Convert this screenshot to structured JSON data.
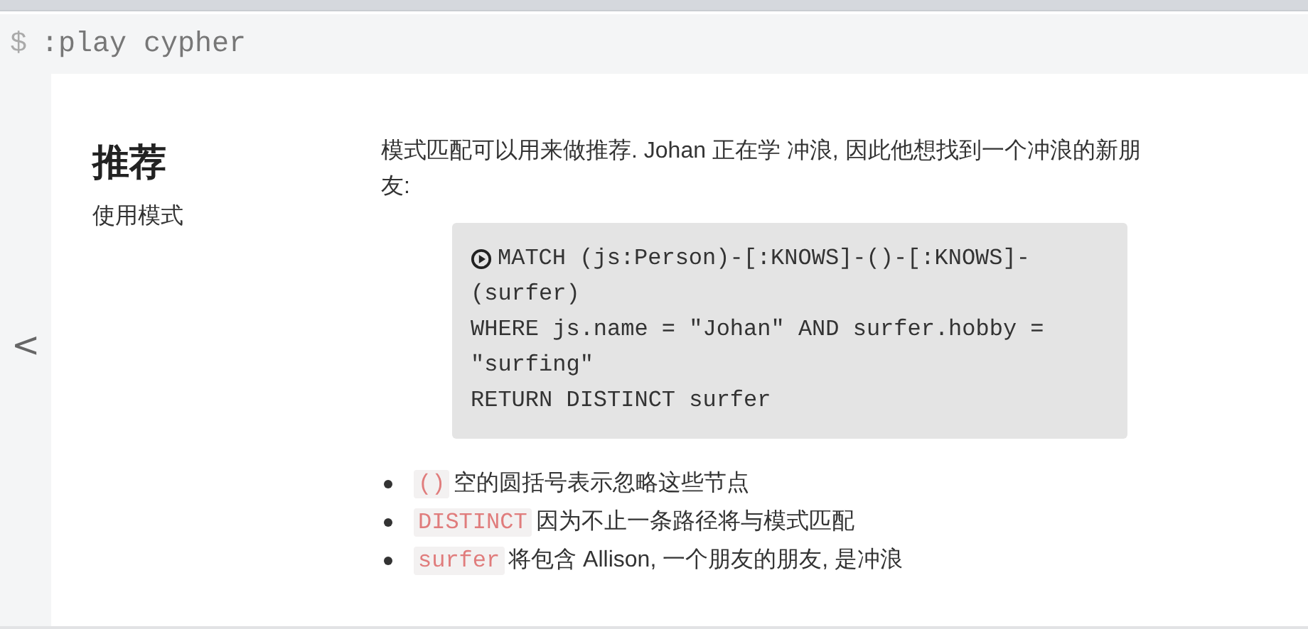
{
  "command_bar": {
    "prompt": "$",
    "command": ":play cypher"
  },
  "slide": {
    "title": "推荐",
    "subtitle": "使用模式",
    "paragraph": "模式匹配可以用来做推荐. Johan 正在学 冲浪, 因此他想找到一个冲浪的新朋友:",
    "code_lines": [
      "MATCH (js:Person)-[:KNOWS]-()-[:KNOWS]-",
      "(surfer)",
      "WHERE js.name = \"Johan\" AND surfer.hobby =",
      "\"surfing\"",
      "RETURN DISTINCT surfer"
    ],
    "bullets": [
      {
        "code": "()",
        "text": "空的圆括号表示忽略这些节点"
      },
      {
        "code": "DISTINCT",
        "text": "因为不止一条路径将与模式匹配"
      },
      {
        "code": "surfer",
        "text": "将包含 Allison, 一个朋友的朋友, 是冲浪"
      }
    ]
  },
  "navigation": {
    "previous": "<"
  }
}
